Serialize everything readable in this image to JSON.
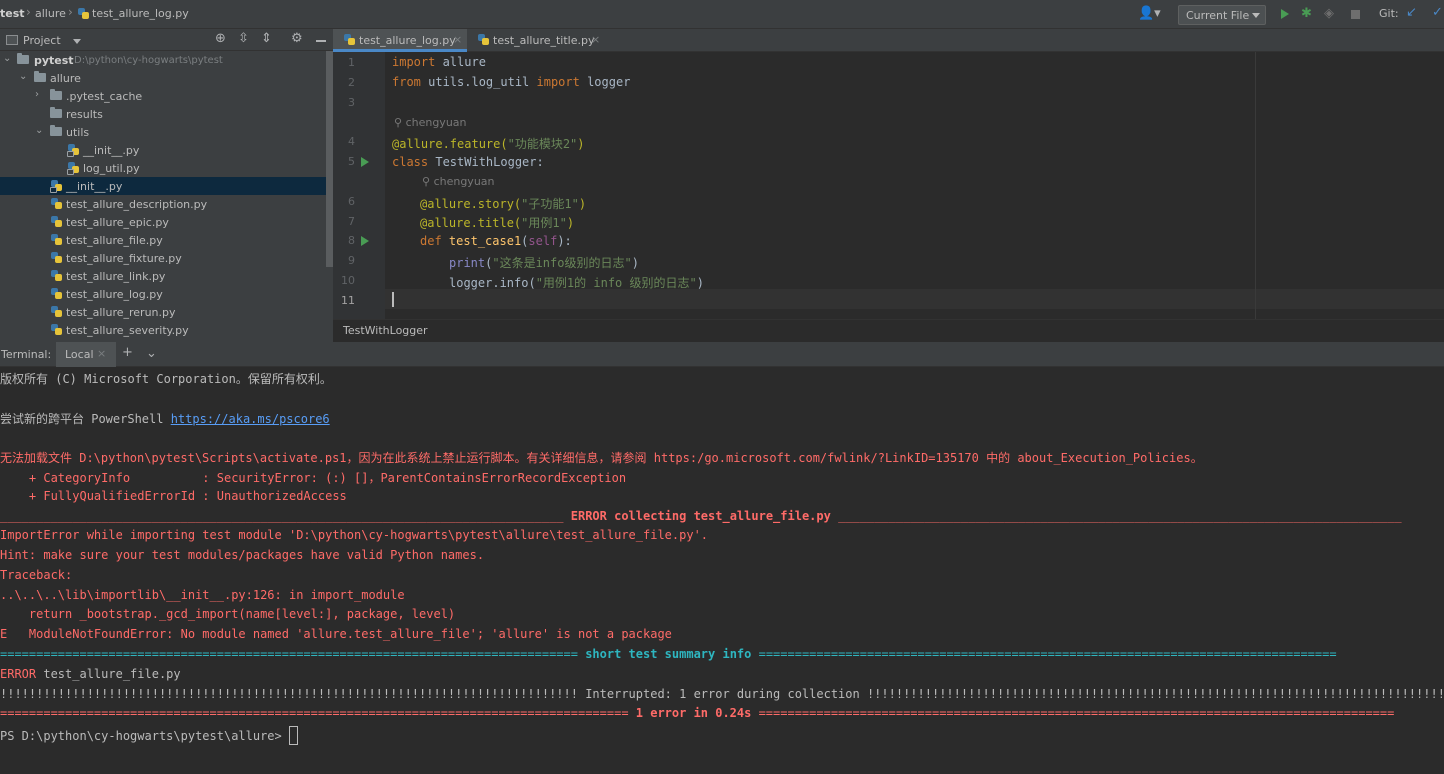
{
  "breadcrumb": [
    "test",
    "allure",
    "test_allure_log.py"
  ],
  "toolbar": {
    "run_config": "Current File",
    "git_label": "Git:"
  },
  "project_panel": {
    "title": "Project",
    "tree": [
      {
        "label": "pytest",
        "path": "D:\\python\\cy-hogwarts\\pytest",
        "type": "folder",
        "expanded": true
      },
      {
        "label": "allure",
        "type": "folder",
        "expanded": true
      },
      {
        "label": ".pytest_cache",
        "type": "folder",
        "expanded": false
      },
      {
        "label": "results",
        "type": "folder"
      },
      {
        "label": "utils",
        "type": "folder",
        "expanded": true
      },
      {
        "label": "__init__.py",
        "type": "python"
      },
      {
        "label": "log_util.py",
        "type": "python"
      },
      {
        "label": "__init__.py",
        "type": "python",
        "selected": true
      },
      {
        "label": "test_allure_description.py",
        "type": "python"
      },
      {
        "label": "test_allure_epic.py",
        "type": "python"
      },
      {
        "label": "test_allure_file.py",
        "type": "python"
      },
      {
        "label": "test_allure_fixture.py",
        "type": "python"
      },
      {
        "label": "test_allure_link.py",
        "type": "python"
      },
      {
        "label": "test_allure_log.py",
        "type": "python"
      },
      {
        "label": "test_allure_rerun.py",
        "type": "python"
      },
      {
        "label": "test_allure_severity.py",
        "type": "python"
      }
    ]
  },
  "editor": {
    "tabs": [
      {
        "label": "test_allure_log.py",
        "active": true
      },
      {
        "label": "test_allure_title.py",
        "active": false
      }
    ],
    "author": "chengyuan",
    "line_numbers": [
      "1",
      "2",
      "3",
      "4",
      "5",
      "6",
      "7",
      "8",
      "9",
      "10",
      "11"
    ],
    "code": {
      "l1": [
        "import",
        " allure"
      ],
      "l2": [
        "from",
        " utils.log_util ",
        "import",
        " logger"
      ],
      "l4": [
        "@allure.feature(",
        "\"功能模块2\"",
        ")"
      ],
      "l5": [
        "class",
        " TestWithLogger:"
      ],
      "l6": [
        "@allure.story(",
        "\"子功能1\"",
        ")"
      ],
      "l7": [
        "@allure.title(",
        "\"用例1\"",
        ")"
      ],
      "l8": [
        "def",
        " ",
        "test_case1",
        "(",
        "self",
        "):"
      ],
      "l9": [
        "print",
        "(",
        "\"这条是info级别的日志\"",
        ")"
      ],
      "l10": [
        "logger.info(",
        "\"用例1的 info 级别的日志\"",
        ")"
      ]
    },
    "breadcrumb": "TestWithLogger"
  },
  "terminal": {
    "label": "Terminal:",
    "tab": "Local",
    "lines": {
      "copyright": "版权所有 (C) Microsoft Corporation。保留所有权利。",
      "ps_try": "尝试新的跨平台 PowerShell ",
      "ps_link": "https://aka.ms/pscore6",
      "err1": "无法加载文件 D:\\python\\pytest\\Scripts\\activate.ps1，因为在此系统上禁止运行脚本。有关详细信息，请参阅 https:/go.microsoft.com/fwlink/?LinkID=135170 中的 about_Execution_Policies。",
      "err2": "    + CategoryInfo          : SecurityError: (:) []，ParentContainsErrorRecordException",
      "err3": "    + FullyQualifiedErrorId : UnauthorizedAccess",
      "sep1_left": "______________________________________________________________________________ ",
      "sep1_mid": "ERROR collecting test_allure_file.py",
      "sep1_right": " ______________________________________________________________________________",
      "e1": "ImportError while importing test module 'D:\\python\\cy-hogwarts\\pytest\\allure\\test_allure_file.py'.",
      "e2": "Hint: make sure your test modules/packages have valid Python names.",
      "e3": "Traceback:",
      "e4": "..\\..\\..\\lib\\importlib\\__init__.py:126: in import_module",
      "e5": "    return _bootstrap._gcd_import(name[level:], package, level)",
      "e6": "E   ModuleNotFoundError: No module named 'allure.test_allure_file'; 'allure' is not a package",
      "sep2_left": "================================================================================ ",
      "sep2_mid": "short test summary info",
      "sep2_right": " ================================================================================",
      "summary_prefix": "ERROR",
      "summary_rest": " test_allure_file.py",
      "interrupted": "!!!!!!!!!!!!!!!!!!!!!!!!!!!!!!!!!!!!!!!!!!!!!!!!!!!!!!!!!!!!!!!!!!!!!!!!!!!!!!!! Interrupted: 1 error during collection !!!!!!!!!!!!!!!!!!!!!!!!!!!!!!!!!!!!!!!!!!!!!!!!!!!!!!!!!!!!!!!!!!!!!!!!!!!!!!!!",
      "sep3_left": "======================================================================================= ",
      "sep3_mid": "1 error in 0.24s",
      "sep3_right": " ========================================================================================",
      "prompt": "PS D:\\python\\cy-hogwarts\\pytest\\allure> "
    }
  }
}
